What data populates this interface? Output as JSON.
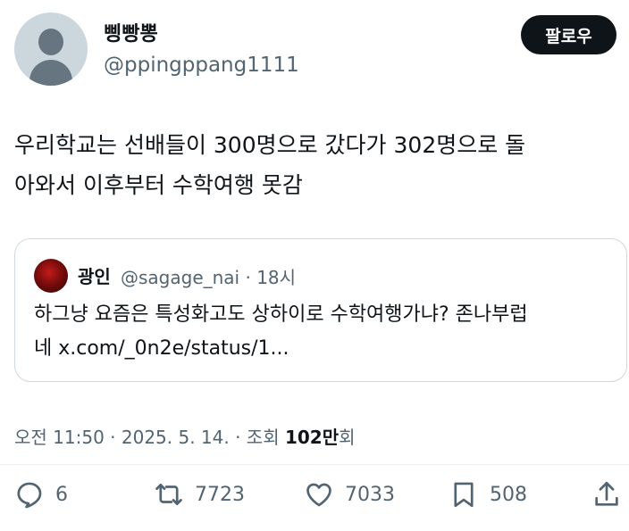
{
  "author": {
    "display_name": "삥빵뽕",
    "handle": "@ppingppang1111"
  },
  "follow_button_label": "팔로우",
  "tweet": {
    "line1": "우리학교는 선배들이 300명으로 갔다가 302명으로 돌",
    "line2": "아와서 이후부터 수학여행 못감"
  },
  "quoted_tweet": {
    "display_name": "광인",
    "handle_time": "@sagage_nai · 18시",
    "line1": "하그냥 요즘은 특성화고도 상하이로 수학여행가냐? 존나부럽",
    "line2": "네 x.com/_0n2e/status/1..."
  },
  "meta": {
    "time_date": "오전 11:50 · 2025. 5. 14. · 조회 ",
    "views_number": "102만",
    "views_suffix": "회"
  },
  "actions": {
    "replies": "6",
    "retweets": "7723",
    "likes": "7033",
    "bookmarks": "508"
  },
  "colors": {
    "text_primary": "#0f1419",
    "text_secondary": "#536471",
    "border": "#cfd9de",
    "button_bg": "#0f1419"
  },
  "icons": [
    "default-avatar-icon",
    "reply-icon",
    "retweet-icon",
    "like-icon",
    "bookmark-icon",
    "share-icon"
  ]
}
